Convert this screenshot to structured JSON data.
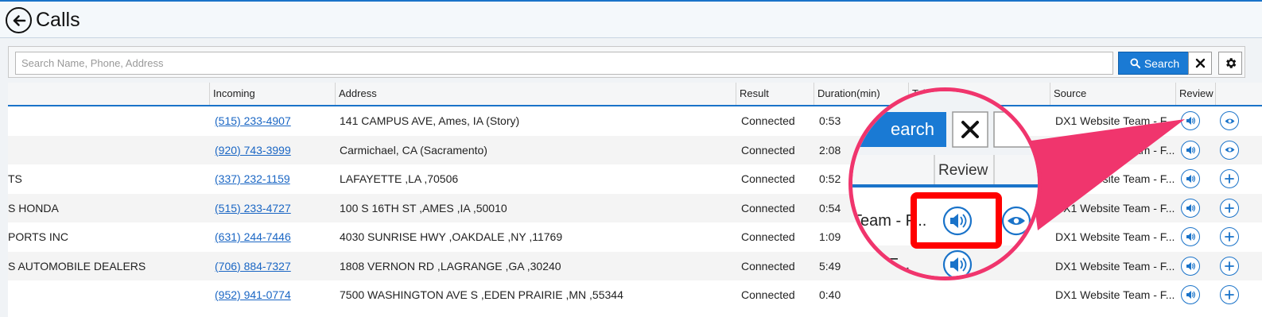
{
  "header": {
    "title": "Calls",
    "back_icon": "back-arrow-icon"
  },
  "search": {
    "placeholder": "Search Name, Phone, Address",
    "value": "",
    "button_label": "Search",
    "search_icon": "search-icon",
    "clear_icon": "close-icon",
    "settings_icon": "gear-icon"
  },
  "table": {
    "columns": [
      "Incoming",
      "Address",
      "Result",
      "Duration(min)",
      "Toll-Free",
      "Source",
      "Review"
    ],
    "rows": [
      {
        "name": "",
        "incoming": "(515) 233-4907",
        "address": "141 CAMPUS AVE, Ames, IA (Story)",
        "result": "Connected",
        "duration": "0:53",
        "tollfree": "",
        "source": "DX1 Website Team - F...",
        "action": "view"
      },
      {
        "name": "",
        "incoming": "(920) 743-3999",
        "address": "Carmichael, CA (Sacramento)",
        "result": "Connected",
        "duration": "2:08",
        "tollfree": "",
        "source": "DX1 Website Team - F...",
        "action": "view"
      },
      {
        "name": "TS",
        "incoming": "(337) 232-1159",
        "address": "LAFAYETTE ,LA ,70506",
        "result": "Connected",
        "duration": "0:52",
        "tollfree": "",
        "source": "DX1 Website Team - F...",
        "action": "add"
      },
      {
        "name": "S HONDA",
        "incoming": "(515) 233-4727",
        "address": "100 S 16TH ST ,AMES ,IA ,50010",
        "result": "Connected",
        "duration": "0:54",
        "tollfree": "",
        "source": "DX1 Website Team - F...",
        "action": "add"
      },
      {
        "name": "PORTS INC",
        "incoming": "(631) 244-7446",
        "address": "4030 SUNRISE HWY ,OAKDALE ,NY ,11769",
        "result": "Connected",
        "duration": "1:09",
        "tollfree": "",
        "source": "DX1 Website Team - F...",
        "action": "add"
      },
      {
        "name": "S AUTOMOBILE DEALERS",
        "incoming": "(706) 884-7327",
        "address": "1808 VERNON RD ,LAGRANGE ,GA ,30240",
        "result": "Connected",
        "duration": "5:49",
        "tollfree": "",
        "source": "DX1 Website Team - F...",
        "action": "add"
      },
      {
        "name": "",
        "incoming": "(952) 941-0774",
        "address": "7500 WASHINGTON AVE S ,EDEN PRAIRIE ,MN ,55344",
        "result": "Connected",
        "duration": "0:40",
        "tollfree": "",
        "source": "DX1 Website Team - F...",
        "action": "add"
      }
    ],
    "review_icon": "speaker-icon",
    "view_icon": "eye-icon",
    "add_icon": "plus-icon"
  },
  "callout": {
    "search_fragment": "earch",
    "review_label": "Review",
    "source_fragment_1": "Team - F...",
    "source_fragment_2": "am - F...",
    "accent": "#f0356d"
  },
  "colors": {
    "accent": "#1a73c9",
    "button": "#1a7ad4",
    "highlight": "#f0356d",
    "link": "#1a66c4"
  }
}
